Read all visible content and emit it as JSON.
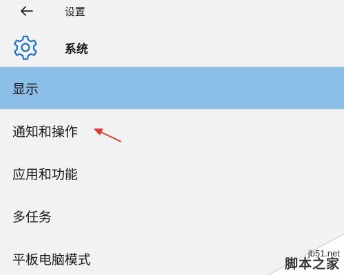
{
  "window": {
    "title": "设置"
  },
  "header": {
    "title": "系统",
    "icon": "gear-icon"
  },
  "nav": {
    "items": [
      {
        "label": "显示",
        "selected": true
      },
      {
        "label": "通知和操作",
        "selected": false
      },
      {
        "label": "应用和功能",
        "selected": false
      },
      {
        "label": "多任务",
        "selected": false
      },
      {
        "label": "平板电脑模式",
        "selected": false
      }
    ]
  },
  "watermark": {
    "site": "jb51.net",
    "name": "脚本之家"
  },
  "colors": {
    "selected_bg": "#8cbfe8",
    "accent": "#1a73c8",
    "arrow": "#e23a2e",
    "background": "#f2f2f2"
  }
}
